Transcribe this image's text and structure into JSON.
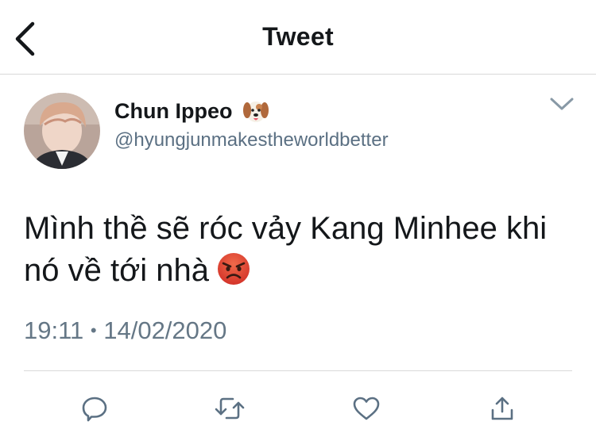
{
  "header": {
    "title": "Tweet"
  },
  "author": {
    "name": "Chun Ippeo",
    "name_emoji": "dog-face-emoji",
    "handle": "@hyungjunmakestheworldbetter"
  },
  "tweet": {
    "text_line1": "Mình thề sẽ róc vảy Kang Minhee khi",
    "text_line2": "nó về tới nhà",
    "emoji": "angry-face-emoji",
    "time": "19:11",
    "separator": "•",
    "date": "14/02/2020"
  },
  "actions": [
    "reply-icon",
    "retweet-icon",
    "like-icon",
    "share-icon"
  ],
  "colors": {
    "icon": "#5b7083",
    "meta": "#657786",
    "text": "#14171a"
  }
}
